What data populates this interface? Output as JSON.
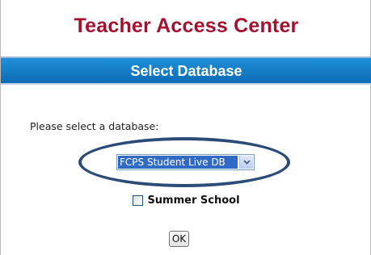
{
  "header": {
    "app_title": "Teacher Access Center",
    "section_title": "Select Database"
  },
  "form": {
    "prompt": "Please select a database:",
    "database_select": {
      "selected_value": "FCPS Student Live DB"
    },
    "summer_school": {
      "label": "Summer School",
      "checked": false
    },
    "ok_label": "OK"
  },
  "colors": {
    "title": "#a5102e",
    "section_bar": "#1a82cc",
    "selection": "#316ac5",
    "annotation_ellipse": "#2b4b78"
  }
}
